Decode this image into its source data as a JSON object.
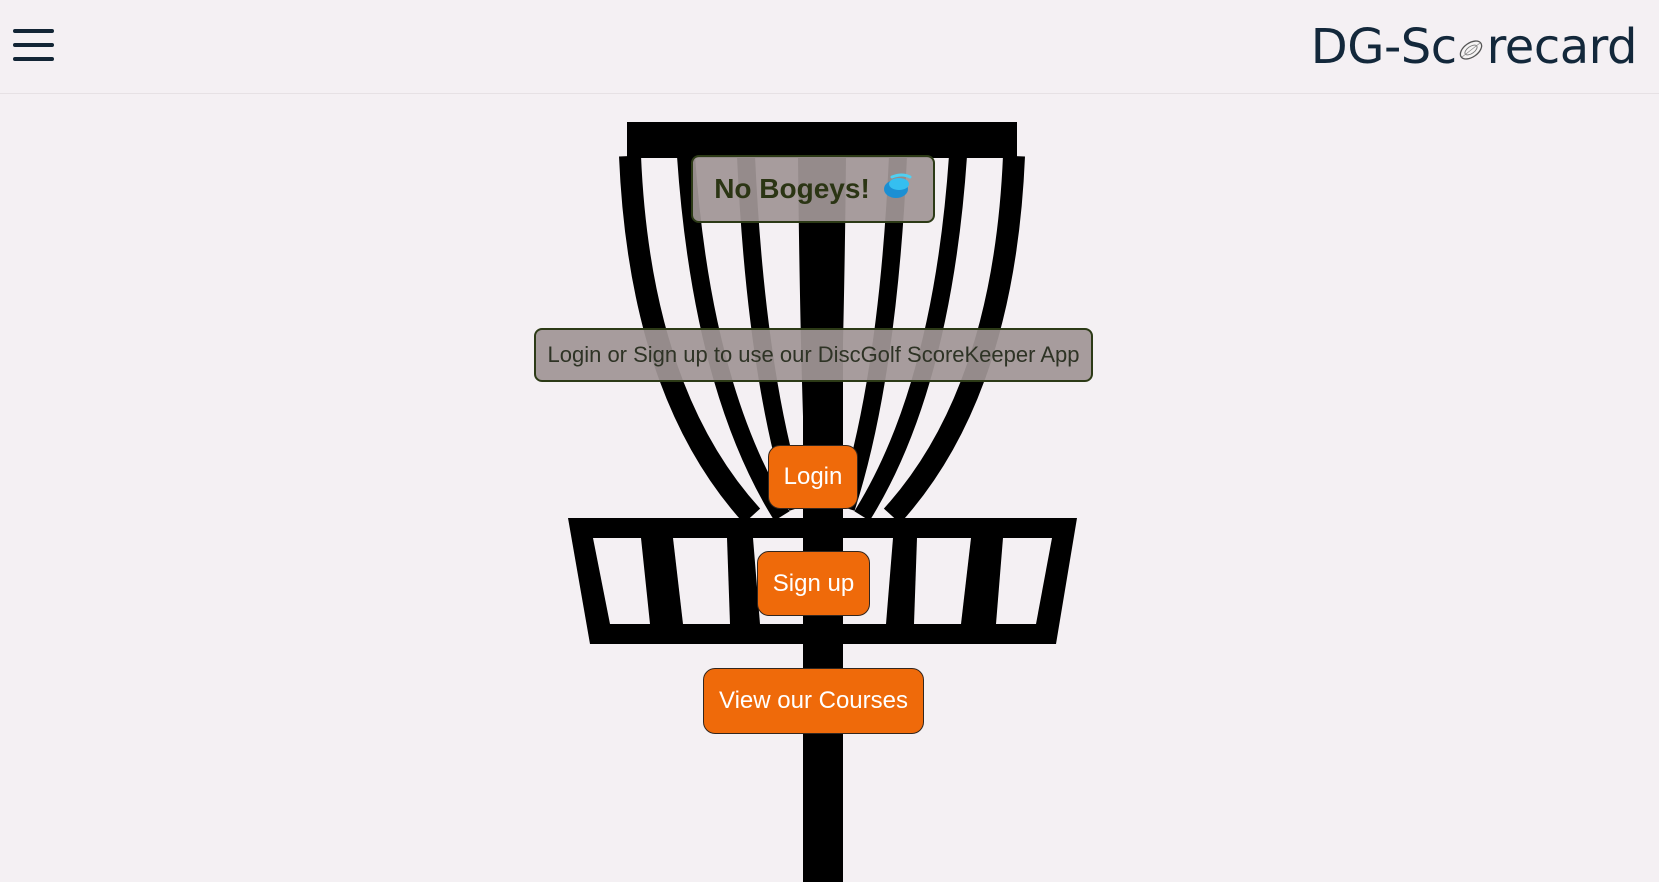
{
  "navbar": {
    "menu_icon": "hamburger-menu-icon",
    "brand_prefix": "DG-Sc",
    "brand_icon": "disc-icon",
    "brand_suffix": "recard"
  },
  "hero": {
    "background_icon": "disc-golf-basket-icon",
    "tagline": "No Bogeys!",
    "tagline_icon": "flying-disc-icon",
    "info_text": "Login or Sign up to use our DiscGolf ScoreKeeper App"
  },
  "actions": {
    "login_label": "Login",
    "signup_label": "Sign up",
    "courses_label": "View our Courses"
  },
  "colors": {
    "accent": "#ef6a0a",
    "brand_text": "#13283b",
    "background": "#f4f0f3"
  }
}
